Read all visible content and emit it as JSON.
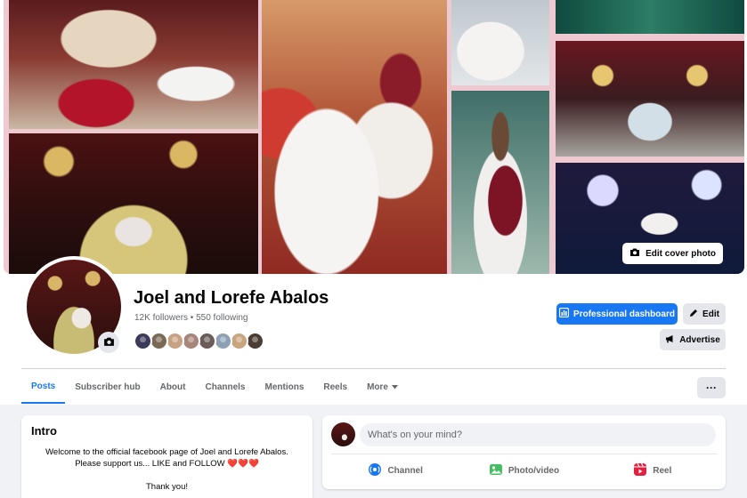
{
  "cover": {
    "edit_label": "Edit cover photo"
  },
  "profile": {
    "name": "Joel and Lorefe Abalos",
    "follow_line": "12K followers • 550 following"
  },
  "actions": {
    "professional_dashboard": "Professional dashboard",
    "edit": "Edit",
    "advertise": "Advertise"
  },
  "tabs": [
    {
      "label": "Posts"
    },
    {
      "label": "Subscriber hub"
    },
    {
      "label": "About"
    },
    {
      "label": "Channels"
    },
    {
      "label": "Mentions"
    },
    {
      "label": "Reels"
    },
    {
      "label": "More"
    }
  ],
  "more_menu_label": "···",
  "intro": {
    "title": "Intro",
    "line1": "Welcome to the official facebook page of Joel and Lorefe Abalos.",
    "line2": "Please support us... LIKE and FOLLOW",
    "hearts": "❤️❤️❤️",
    "thanks": "Thank you!"
  },
  "composer": {
    "placeholder": "What's on your mind?",
    "actions": [
      {
        "label": "Channel",
        "icon": "channel-icon",
        "color": "#1877f2"
      },
      {
        "label": "Photo/video",
        "icon": "photo-video-icon",
        "color": "#45bd62"
      },
      {
        "label": "Reel",
        "icon": "reel-icon",
        "color": "#e41e3f"
      }
    ]
  },
  "colors": {
    "accent": "#1877f2",
    "page_bg": "#f0f2f5",
    "button_gray": "#e4e6eb",
    "muted_text": "#65676b"
  },
  "follower_avatar_colors": [
    "#3b3a5a",
    "#7a6a55",
    "#c7a183",
    "#a8857a",
    "#6b5c59",
    "#8ea0b4",
    "#c9a57f",
    "#4a3d33"
  ]
}
